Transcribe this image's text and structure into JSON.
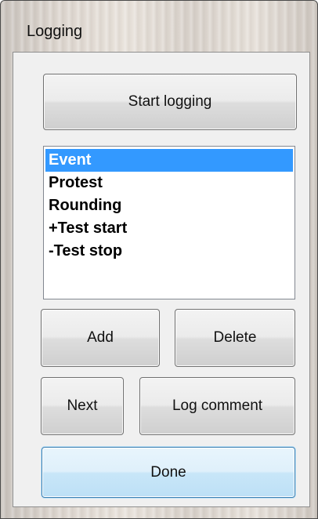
{
  "window": {
    "title": "Logging"
  },
  "buttons": {
    "start_logging": "Start logging",
    "add": "Add",
    "delete": "Delete",
    "next": "Next",
    "log_comment": "Log comment",
    "done": "Done"
  },
  "event_list": {
    "selected_index": 0,
    "items": [
      {
        "label": "Event"
      },
      {
        "label": "Protest"
      },
      {
        "label": "Rounding"
      },
      {
        "label": "+Test start"
      },
      {
        "label": "-Test stop"
      }
    ]
  },
  "colors": {
    "selection": "#3399ff",
    "focus_border": "#3c7fb1",
    "client_bg": "#f0f0f0"
  }
}
